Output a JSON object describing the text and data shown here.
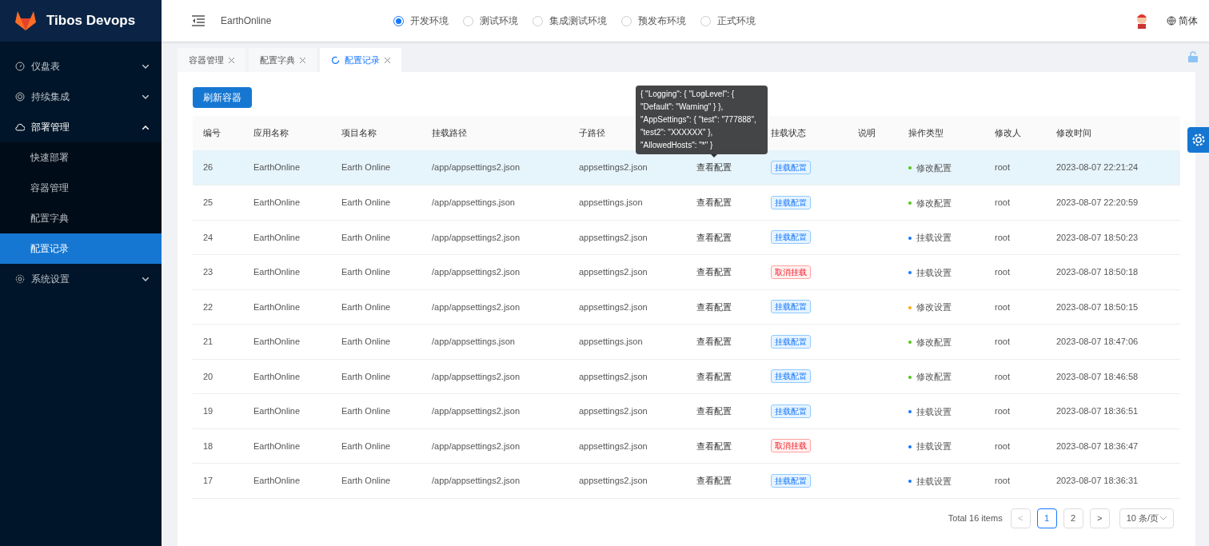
{
  "brand": {
    "title": "Tibos Devops"
  },
  "sidebar": {
    "items": [
      {
        "label": "仪盘表",
        "kind": "gauge",
        "expanded": false
      },
      {
        "label": "持续集成",
        "kind": "circle",
        "expanded": false
      },
      {
        "label": "部署管理",
        "kind": "cloud",
        "expanded": true,
        "children": [
          {
            "label": "快速部署",
            "selected": false
          },
          {
            "label": "容器管理",
            "selected": false
          },
          {
            "label": "配置字典",
            "selected": false
          },
          {
            "label": "配置记录",
            "selected": true
          }
        ]
      },
      {
        "label": "系统设置",
        "kind": "gear",
        "expanded": false
      }
    ]
  },
  "header": {
    "project": "EarthOnline",
    "environments": [
      {
        "label": "开发环境",
        "selected": true
      },
      {
        "label": "测试环境",
        "selected": false
      },
      {
        "label": "集成测试环境",
        "selected": false
      },
      {
        "label": "预发布环境",
        "selected": false
      },
      {
        "label": "正式环境",
        "selected": false
      }
    ],
    "language": "简体"
  },
  "tabs": [
    {
      "label": "容器管理",
      "selected": false
    },
    {
      "label": "配置字典",
      "selected": false
    },
    {
      "label": "配置记录",
      "selected": true
    }
  ],
  "toolbar": {
    "refresh_button": "刷新容器"
  },
  "table": {
    "columns": [
      {
        "label": "编号"
      },
      {
        "label": "应用名称"
      },
      {
        "label": "项目名称"
      },
      {
        "label": "挂载路径"
      },
      {
        "label": "子路径"
      },
      {},
      {
        "label": "挂载状态"
      },
      {
        "label": "说明"
      },
      {
        "label": "操作类型"
      },
      {
        "label": "修改人"
      },
      {
        "label": "修改时间"
      }
    ],
    "rows": [
      {
        "id": "26",
        "app": "EarthOnline",
        "project": "Earth Online",
        "path": "/app/appsettings2.json",
        "subpath": "appsettings2.json",
        "action": "查看配置",
        "status": {
          "kind": "mounted",
          "label": "挂载配置"
        },
        "op": {
          "label": "修改配置",
          "color": "#52c41a"
        },
        "user": "root",
        "time": "2023-08-07 22:21:24",
        "selected": true
      },
      {
        "id": "25",
        "app": "EarthOnline",
        "project": "Earth Online",
        "path": "/app/appsettings.json",
        "subpath": "appsettings.json",
        "action": "查看配置",
        "status": {
          "kind": "mounted",
          "label": "挂载配置"
        },
        "op": {
          "label": "修改配置",
          "color": "#52c41a"
        },
        "user": "root",
        "time": "2023-08-07 22:20:59",
        "selected": false
      },
      {
        "id": "24",
        "app": "EarthOnline",
        "project": "Earth Online",
        "path": "/app/appsettings2.json",
        "subpath": "appsettings2.json",
        "action": "查看配置",
        "status": {
          "kind": "mounted",
          "label": "挂载配置"
        },
        "op": {
          "label": "挂载设置",
          "color": "#1677ff"
        },
        "user": "root",
        "time": "2023-08-07 18:50:23",
        "selected": false
      },
      {
        "id": "23",
        "app": "EarthOnline",
        "project": "Earth Online",
        "path": "/app/appsettings2.json",
        "subpath": "appsettings2.json",
        "action": "查看配置",
        "status": {
          "kind": "unmounted",
          "label": "取消挂载"
        },
        "op": {
          "label": "挂载设置",
          "color": "#1677ff"
        },
        "user": "root",
        "time": "2023-08-07 18:50:18",
        "selected": false
      },
      {
        "id": "22",
        "app": "EarthOnline",
        "project": "Earth Online",
        "path": "/app/appsettings2.json",
        "subpath": "appsettings2.json",
        "action": "查看配置",
        "status": {
          "kind": "mounted",
          "label": "挂载配置"
        },
        "op": {
          "label": "修改设置",
          "color": "#faad14"
        },
        "user": "root",
        "time": "2023-08-07 18:50:15",
        "selected": false
      },
      {
        "id": "21",
        "app": "EarthOnline",
        "project": "Earth Online",
        "path": "/app/appsettings.json",
        "subpath": "appsettings.json",
        "action": "查看配置",
        "status": {
          "kind": "mounted",
          "label": "挂载配置"
        },
        "op": {
          "label": "修改配置",
          "color": "#52c41a"
        },
        "user": "root",
        "time": "2023-08-07 18:47:06",
        "selected": false
      },
      {
        "id": "20",
        "app": "EarthOnline",
        "project": "Earth Online",
        "path": "/app/appsettings2.json",
        "subpath": "appsettings2.json",
        "action": "查看配置",
        "status": {
          "kind": "mounted",
          "label": "挂载配置"
        },
        "op": {
          "label": "修改配置",
          "color": "#52c41a"
        },
        "user": "root",
        "time": "2023-08-07 18:46:58",
        "selected": false
      },
      {
        "id": "19",
        "app": "EarthOnline",
        "project": "Earth Online",
        "path": "/app/appsettings2.json",
        "subpath": "appsettings2.json",
        "action": "查看配置",
        "status": {
          "kind": "mounted",
          "label": "挂载配置"
        },
        "op": {
          "label": "挂载设置",
          "color": "#1677ff"
        },
        "user": "root",
        "time": "2023-08-07 18:36:51",
        "selected": false
      },
      {
        "id": "18",
        "app": "EarthOnline",
        "project": "Earth Online",
        "path": "/app/appsettings2.json",
        "subpath": "appsettings2.json",
        "action": "查看配置",
        "status": {
          "kind": "unmounted",
          "label": "取消挂载"
        },
        "op": {
          "label": "挂载设置",
          "color": "#1677ff"
        },
        "user": "root",
        "time": "2023-08-07 18:36:47",
        "selected": false
      },
      {
        "id": "17",
        "app": "EarthOnline",
        "project": "Earth Online",
        "path": "/app/appsettings2.json",
        "subpath": "appsettings2.json",
        "action": "查看配置",
        "status": {
          "kind": "mounted",
          "label": "挂载配置"
        },
        "op": {
          "label": "挂载设置",
          "color": "#1677ff"
        },
        "user": "root",
        "time": "2023-08-07 18:36:31",
        "selected": false
      }
    ]
  },
  "tooltip": {
    "text": "{ \"Logging\": { \"LogLevel\": { \"Default\": \"Warning\" } }, \"AppSettings\": { \"test\": \"777888\", \"test2\": \"XXXXXX\" }, \"AllowedHosts\": \"*\" }"
  },
  "pagination": {
    "total": "Total 16 items",
    "prev": "<",
    "pages": [
      {
        "label": "1",
        "selected": true
      },
      {
        "label": "2",
        "selected": false
      }
    ],
    "next": ">",
    "page_size": "10 条/页"
  }
}
